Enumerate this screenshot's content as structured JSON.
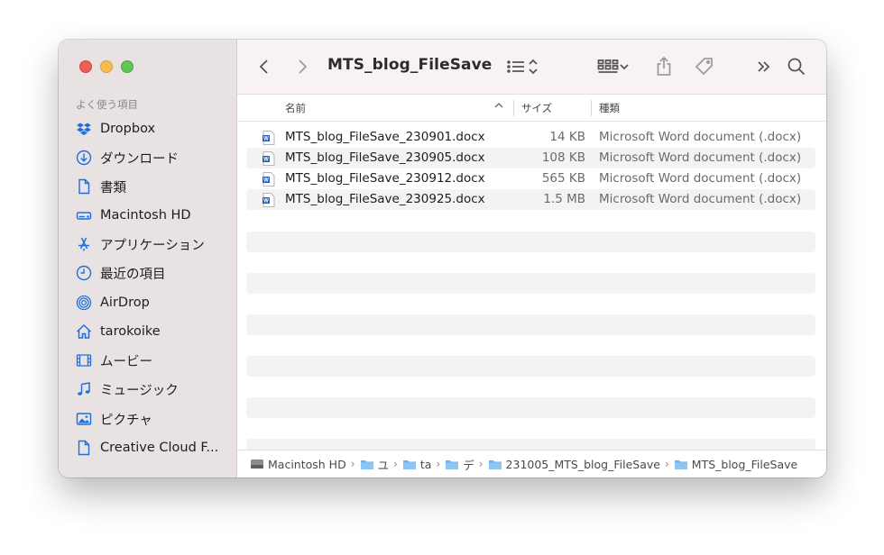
{
  "window": {
    "title": "MTS_blog_FileSave"
  },
  "sidebar": {
    "section_label": "よく使う項目",
    "items": [
      {
        "label": "Dropbox",
        "icon": "dropbox-icon"
      },
      {
        "label": "ダウンロード",
        "icon": "download-icon"
      },
      {
        "label": "書類",
        "icon": "document-icon"
      },
      {
        "label": "Macintosh HD",
        "icon": "hard-drive-icon"
      },
      {
        "label": "アプリケーション",
        "icon": "applications-icon"
      },
      {
        "label": "最近の項目",
        "icon": "clock-icon"
      },
      {
        "label": "AirDrop",
        "icon": "airdrop-icon"
      },
      {
        "label": "tarokoike",
        "icon": "home-icon"
      },
      {
        "label": "ムービー",
        "icon": "film-icon"
      },
      {
        "label": "ミュージック",
        "icon": "music-icon"
      },
      {
        "label": "ピクチャ",
        "icon": "picture-icon"
      },
      {
        "label": "Creative Cloud F...",
        "icon": "file-icon"
      }
    ]
  },
  "columns": {
    "name": "名前",
    "size": "サイズ",
    "kind": "種類"
  },
  "files": [
    {
      "name": "MTS_blog_FileSave_230901.docx",
      "size": "14 KB",
      "kind": "Microsoft Word document (.docx)"
    },
    {
      "name": "MTS_blog_FileSave_230905.docx",
      "size": "108 KB",
      "kind": "Microsoft Word document (.docx)"
    },
    {
      "name": "MTS_blog_FileSave_230912.docx",
      "size": "565 KB",
      "kind": "Microsoft Word document (.docx)"
    },
    {
      "name": "MTS_blog_FileSave_230925.docx",
      "size": "1.5 MB",
      "kind": "Microsoft Word document (.docx)"
    }
  ],
  "pathbar": [
    {
      "label": "Macintosh HD",
      "icon": "hard-drive-icon"
    },
    {
      "label": "ユ",
      "icon": "folder-icon"
    },
    {
      "label": "ta",
      "icon": "folder-icon"
    },
    {
      "label": "デ",
      "icon": "folder-icon"
    },
    {
      "label": "231005_MTS_blog_FileSave",
      "icon": "folder-icon"
    },
    {
      "label": "MTS_blog_FileSave",
      "icon": "folder-icon"
    }
  ],
  "colors": {
    "accent": "#1e6fd9",
    "sidebar_bg": "#e8e2e2",
    "toolbar_bg": "#f8f2f2"
  }
}
